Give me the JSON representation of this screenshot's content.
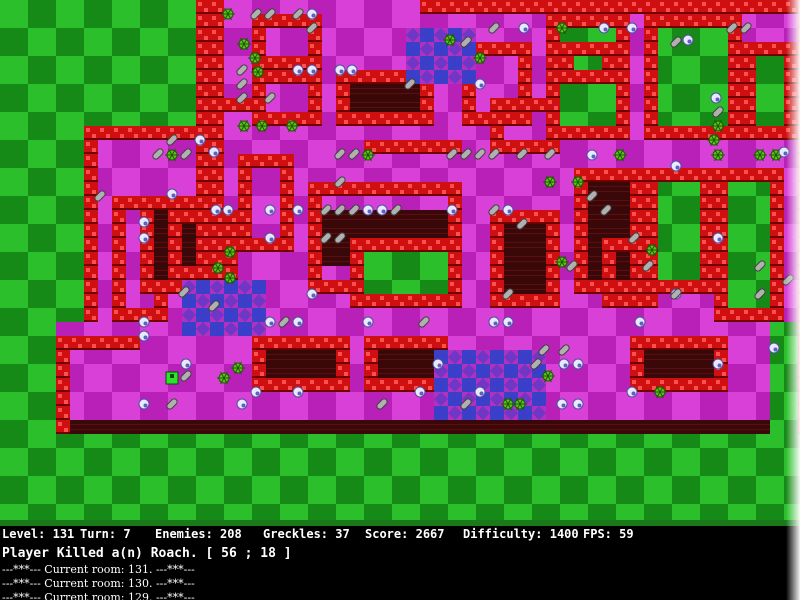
{
  "hud": {
    "stats": [
      {
        "label": "Level:",
        "value": "131"
      },
      {
        "label": "Turn:",
        "value": "7"
      },
      {
        "label": "Enemies:",
        "value": "208"
      },
      {
        "label": "Greckles:",
        "value": "37"
      },
      {
        "label": "Score:",
        "value": "2667"
      },
      {
        "label": "Difficulty:",
        "value": "1400"
      },
      {
        "label": "FPS:",
        "value": "59"
      }
    ],
    "message": "Player Killed a(n) Roach. [ 56 ; 18 ]",
    "log": [
      "---***---  Current room: 131.  ---***---",
      "---***---  Current room: 130.  ---***---",
      "---***---  Current room: 129.  ---***---"
    ]
  },
  "colors": {
    "grass_light": "#2bc02b",
    "grass_dark": "#168a16",
    "floor_light": "#d840d8",
    "floor_dark": "#b820b8",
    "wall": "#d01010",
    "pit": "#3a0808",
    "water_a": "#3a40c8",
    "water_b": "#b030c0",
    "roach": "#60c020",
    "player": "#30e030",
    "orb": "#e8e8ff",
    "hud_bg": "#000000",
    "hud_text": "#ffffff"
  },
  "icons": {
    "roach": "green-roach-icon",
    "orb": "white-orb-icon",
    "potion": "grey-capsule-icon",
    "player": "green-player-icon"
  }
}
